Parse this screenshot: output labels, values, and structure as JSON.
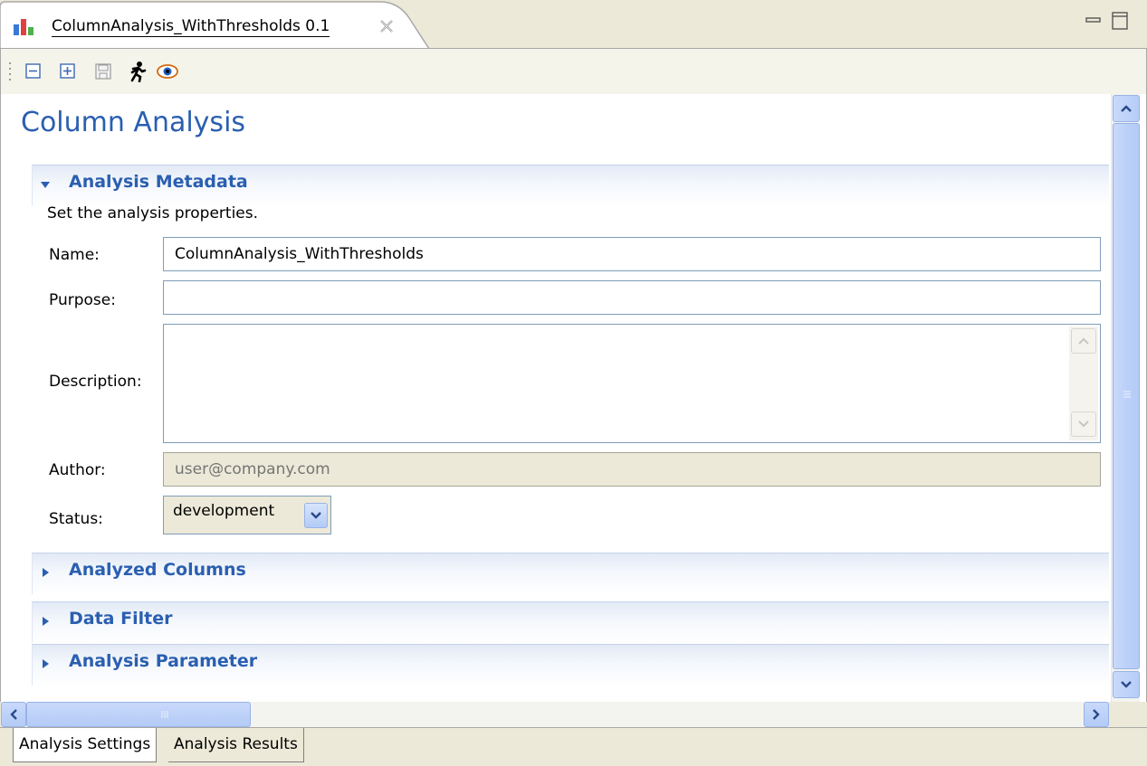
{
  "tab": {
    "title": "ColumnAnalysis_WithThresholds 0.1",
    "icon": "bar-chart-icon"
  },
  "toolbar": {
    "buttons": [
      "collapse-all-icon",
      "expand-all-icon",
      "save-icon",
      "run-icon",
      "preview-icon"
    ]
  },
  "form": {
    "title": "Column Analysis",
    "sections": [
      {
        "title": "Analysis Metadata",
        "expanded": true
      },
      {
        "title": "Analyzed Columns",
        "expanded": false
      },
      {
        "title": "Data Filter",
        "expanded": false
      },
      {
        "title": "Analysis Parameter",
        "expanded": false
      }
    ],
    "metadata": {
      "description_text": "Set the analysis properties.",
      "name_label": "Name:",
      "name_value": "ColumnAnalysis_WithThresholds",
      "purpose_label": "Purpose:",
      "purpose_value": "",
      "description_label": "Description:",
      "description_value": "",
      "author_label": "Author:",
      "author_placeholder": "user@company.com",
      "status_label": "Status:",
      "status_value": "development"
    }
  },
  "pages": [
    {
      "label": "Analysis Settings",
      "active": true
    },
    {
      "label": "Analysis Results",
      "active": false
    }
  ],
  "colors": {
    "accent": "#2a5fb0",
    "scrollbar": "#b6cdf8"
  }
}
